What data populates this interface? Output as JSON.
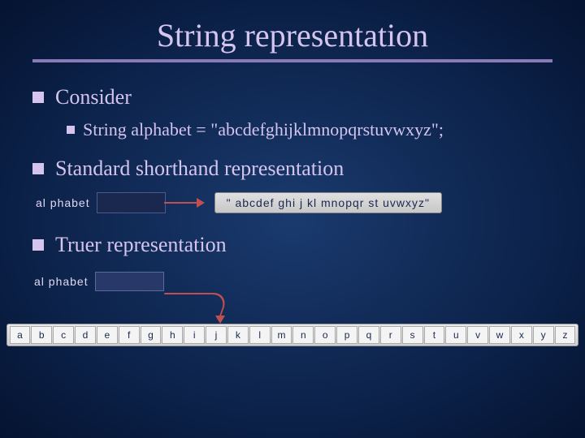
{
  "title": "String representation",
  "bullets": {
    "consider": "Consider",
    "code": "String alphabet = \"abcdefghijklmnopqrstuvwxyz\";",
    "standard": "Standard shorthand representation",
    "truer": "Truer representation"
  },
  "diagram1": {
    "var_label": "al phabet",
    "string_value": "\" abcdef ghi j kl mnopqr st uvwxyz\""
  },
  "diagram2": {
    "var_label": "al phabet",
    "chars": [
      "a",
      "b",
      "c",
      "d",
      "e",
      "f",
      "g",
      "h",
      "i",
      "j",
      "k",
      "l",
      "m",
      "n",
      "o",
      "p",
      "q",
      "r",
      "s",
      "t",
      "u",
      "v",
      "w",
      "x",
      "y",
      "z"
    ]
  }
}
